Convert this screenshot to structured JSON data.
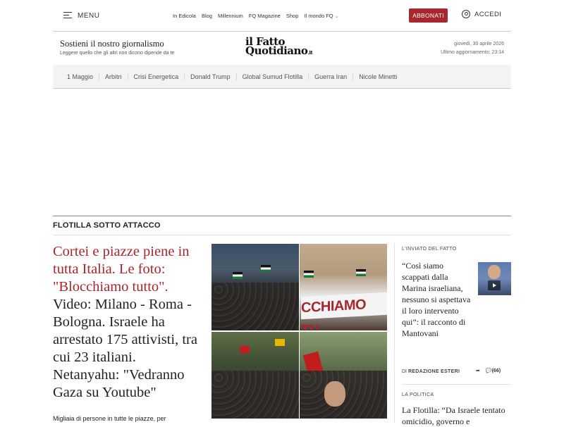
{
  "topbar": {
    "menu_label": "MENU",
    "nav": [
      "In Edicola",
      "Blog",
      "Millennium",
      "FQ Magazine",
      "Shop",
      "Il mondo FQ"
    ],
    "subscribe_label": "ABBONATI",
    "login_label": "ACCEDI"
  },
  "masthead": {
    "support_title": "Sostieni il nostro giornalismo",
    "support_sub": "Leggere quello che gli altri non dicono dipende da te",
    "logo_line1": "il Fatto",
    "logo_line2": "Quotidiano",
    "logo_suffix": ".it",
    "date": "giovedì, 30 aprile 2026",
    "updated": "Ultimo aggiornamento: 23:14"
  },
  "topics": [
    "1 Maggio",
    "Arbitri",
    "Crisi Energetica",
    "Donald Trump",
    "Global Sumud Flotilla",
    "Guerra Iran",
    "Nicole Minetti"
  ],
  "section": {
    "title": "FLOTILLA SOTTO ATTACCO"
  },
  "main_story": {
    "headline_red": "Cortei e piazze piene in tutta Italia. Le foto: \"Blocchiamo tutto\".",
    "headline_rest": " Video: Milano - Roma - Bologna. Israele ha arrestato 175 attivisti, tra cui 23 italiani. Netanyahu: \"Vedranno Gaza su Youtube\"",
    "lede": "Migliaia di persone in tutte le piazze, per",
    "photo_banner": "CCHIAMO TU"
  },
  "side": {
    "kicker1": "L'INVIATO DEL FATTO",
    "title1": "“Così siamo scappati dalla Marina israeliana, nessuno si aspettava il loro intervento qui”: il racconto di Mantovani",
    "byline_prefix": "DI",
    "byline_author": "REDAZIONE ESTERI",
    "comments": "(66)",
    "kicker2": "LA POLITICA",
    "title2": "La Flotilla: “Da Israele tentato omicidio, governo e"
  }
}
